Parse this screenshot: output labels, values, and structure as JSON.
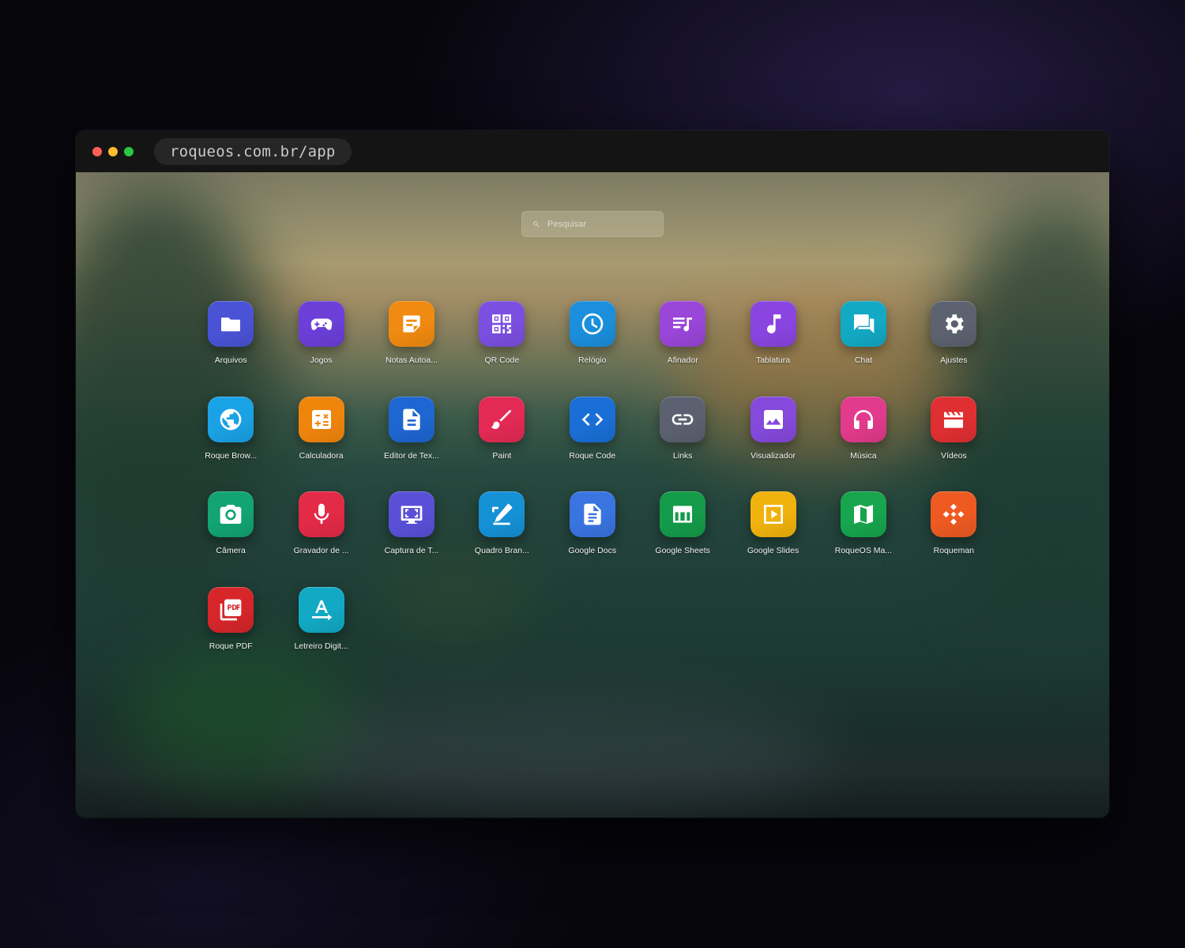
{
  "browser": {
    "url": "roqueos.com.br/app"
  },
  "search": {
    "placeholder": "Pesquisar"
  },
  "apps": [
    {
      "label": "Arquivos",
      "icon": "folder-icon",
      "color": "#4a53d6"
    },
    {
      "label": "Jogos",
      "icon": "gamepad-icon",
      "color": "#6b3fd8"
    },
    {
      "label": "Notas Autoa...",
      "icon": "note-icon",
      "color": "#f08a10"
    },
    {
      "label": "QR Code",
      "icon": "qr-code-icon",
      "color": "#7b4fe0"
    },
    {
      "label": "Relógio",
      "icon": "clock-icon",
      "color": "#1b8fdc"
    },
    {
      "label": "Afinador",
      "icon": "music-list-icon",
      "color": "#9a46d8"
    },
    {
      "label": "Tablatura",
      "icon": "music-note-icon",
      "color": "#8a45e0"
    },
    {
      "label": "Chat",
      "icon": "chat-icon",
      "color": "#12a9c4"
    },
    {
      "label": "Ajustes",
      "icon": "gear-icon",
      "color": "#5d6270"
    },
    {
      "label": "Roque Brow...",
      "icon": "globe-icon",
      "color": "#1aa2e6"
    },
    {
      "label": "Calculadora",
      "icon": "calculator-icon",
      "color": "#f0850c"
    },
    {
      "label": "Editor de Tex...",
      "icon": "document-icon",
      "color": "#1e66d2"
    },
    {
      "label": "Paint",
      "icon": "brush-icon",
      "color": "#e32a55"
    },
    {
      "label": "Roque Code",
      "icon": "code-icon",
      "color": "#1a6fd6"
    },
    {
      "label": "Links",
      "icon": "link-icon",
      "color": "#5b6170"
    },
    {
      "label": "Visualizador",
      "icon": "image-icon",
      "color": "#8549dc"
    },
    {
      "label": "Música",
      "icon": "headphones-icon",
      "color": "#e23a8c"
    },
    {
      "label": "Vídeos",
      "icon": "clapperboard-icon",
      "color": "#e02f32"
    },
    {
      "label": "Câmera",
      "icon": "camera-icon",
      "color": "#12a473"
    },
    {
      "label": "Gravador de ...",
      "icon": "microphone-icon",
      "color": "#e32a47"
    },
    {
      "label": "Captura de T...",
      "icon": "screen-capture-icon",
      "color": "#5a50d8"
    },
    {
      "label": "Quadro Bran...",
      "icon": "pen-icon",
      "color": "#1591d6"
    },
    {
      "label": "Google Docs",
      "icon": "google-docs-icon",
      "color": "#3a74e0"
    },
    {
      "label": "Google Sheets",
      "icon": "google-sheets-icon",
      "color": "#149b4a"
    },
    {
      "label": "Google Slides",
      "icon": "google-slides-icon",
      "color": "#f0b20c"
    },
    {
      "label": "RoqueOS Ma...",
      "icon": "map-icon",
      "color": "#17a54d"
    },
    {
      "label": "Roqueman",
      "icon": "roqueman-icon",
      "color": "#ee5a22"
    },
    {
      "label": "Roque PDF",
      "icon": "pdf-icon",
      "color": "#d6262a"
    },
    {
      "label": "Letreiro Digit...",
      "icon": "text-marquee-icon",
      "color": "#12a9c4"
    }
  ]
}
